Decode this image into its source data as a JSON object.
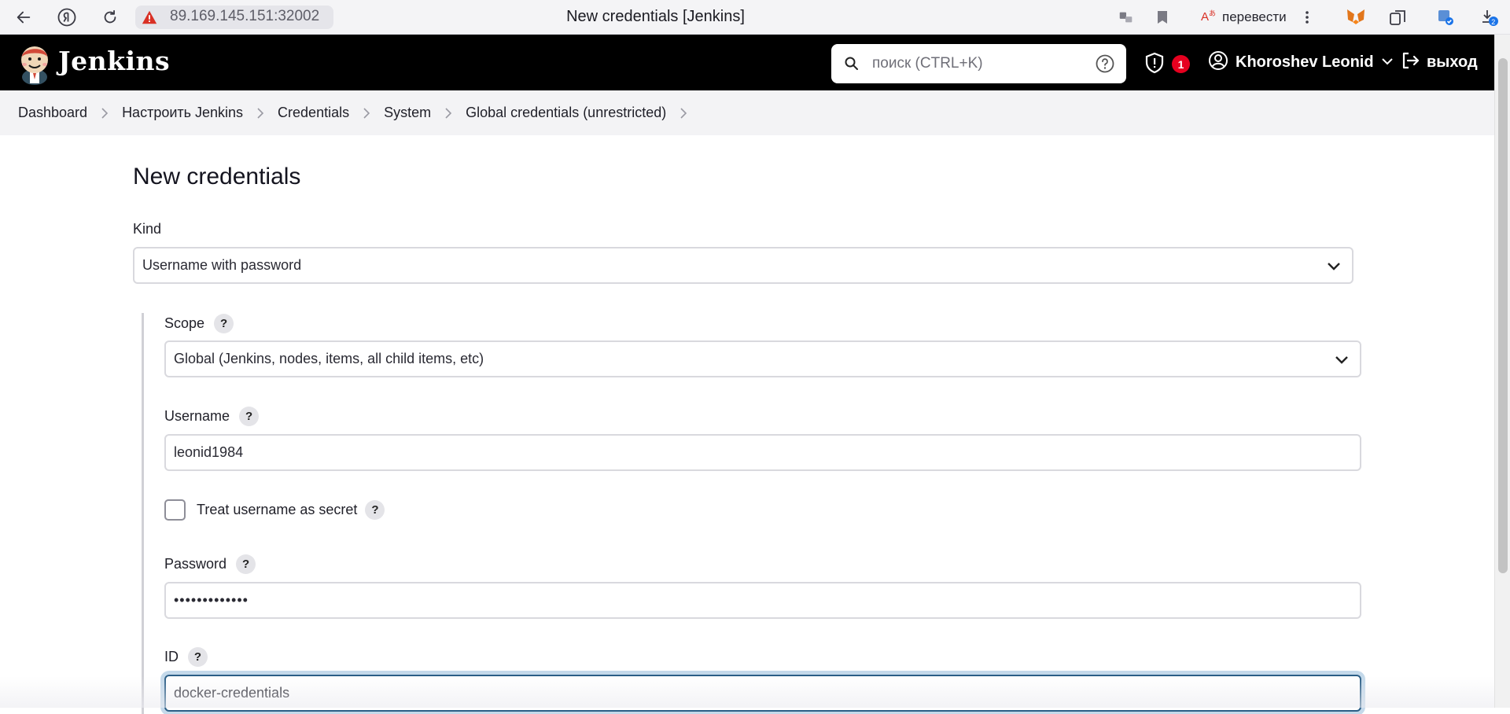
{
  "browser": {
    "url": "89.169.145.151:32002",
    "tab_title": "New credentials [Jenkins]",
    "translate_label": "перевести",
    "downloads_count": "2",
    "icons": [
      "back-icon",
      "yandex-icon",
      "reload-icon",
      "security-warning-icon",
      "translate-page-icon",
      "bookmark-icon",
      "translate-icon",
      "more-icon",
      "metamask-icon",
      "collections-icon",
      "extension-icon",
      "downloads-icon"
    ]
  },
  "header": {
    "brand": "Jenkins",
    "search": {
      "placeholder": "поиск (CTRL+K)"
    },
    "security_count": "1",
    "user_name": "Khoroshev Leonid",
    "logout_label": "выход"
  },
  "breadcrumb": {
    "items": [
      "Dashboard",
      "Настроить Jenkins",
      "Credentials",
      "System",
      "Global credentials (unrestricted)"
    ]
  },
  "form": {
    "title": "New credentials",
    "kind": {
      "label": "Kind",
      "value": "Username with password"
    },
    "scope": {
      "label": "Scope",
      "value": "Global (Jenkins, nodes, items, all child items, etc)"
    },
    "username": {
      "label": "Username",
      "value": "leonid1984"
    },
    "treat_secret": {
      "label": "Treat username as secret",
      "checked": false
    },
    "password": {
      "label": "Password",
      "value": "•••••••••••••"
    },
    "id": {
      "label": "ID",
      "value": "docker-credentials"
    },
    "help_glyph": "?"
  },
  "colors": {
    "header_bg": "#000000",
    "badge_red": "#e6001f",
    "focus_border": "#2b5e86",
    "breadcrumb_bg": "#f3f3f5"
  }
}
